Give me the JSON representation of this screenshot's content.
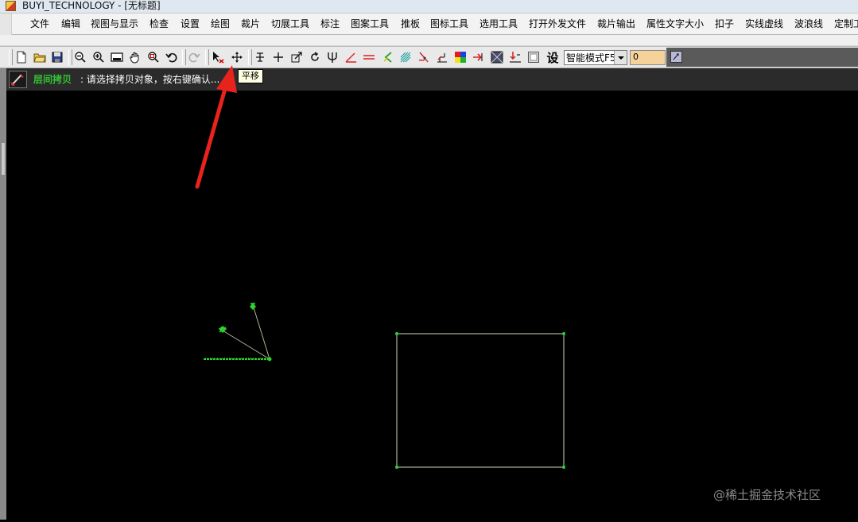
{
  "titlebar": {
    "title": "BUYI_TECHNOLOGY - [无标题]"
  },
  "menu": [
    "文件",
    "编辑",
    "视图与显示",
    "检查",
    "设置",
    "绘图",
    "裁片",
    "切展工具",
    "标注",
    "图案工具",
    "推板",
    "图标工具",
    "选用工具",
    "打开外发文件",
    "裁片输出",
    "属性文字大小",
    "扣子",
    "实线虚线",
    "波浪线",
    "定制工"
  ],
  "toolbar": {
    "buttons": [
      "new-file-icon",
      "open-folder-icon",
      "save-icon",
      "zoom-out-icon",
      "zoom-in-icon",
      "fit-view-icon",
      "hand-pan-icon",
      "zoom-window-icon",
      "undo-icon",
      "redo-icon",
      "select-delete-icon",
      "move-icon",
      "text-icon",
      "cross-icon",
      "scale-icon",
      "rotate-icon",
      "fork-icon",
      "angle-icon",
      "parallel-line-icon",
      "notch-icon",
      "hatch-icon",
      "seam-icon",
      "grading-icon",
      "color-palette-icon",
      "arrow-point-icon",
      "pattern-fill-icon",
      "mirror-down-icon",
      "box-icon"
    ],
    "setting_label": "设",
    "mode_select": "智能模式F5",
    "value_input": "0"
  },
  "status": {
    "title": "层间拷贝",
    "message": ": 请选择拷贝对象，按右键确认..."
  },
  "tooltip": "平移",
  "watermark": "@稀土掘金技术社区",
  "colors": {
    "canvas": "#000000",
    "drawing_green": "#2bd42b",
    "annotation_red": "#e8231c"
  }
}
